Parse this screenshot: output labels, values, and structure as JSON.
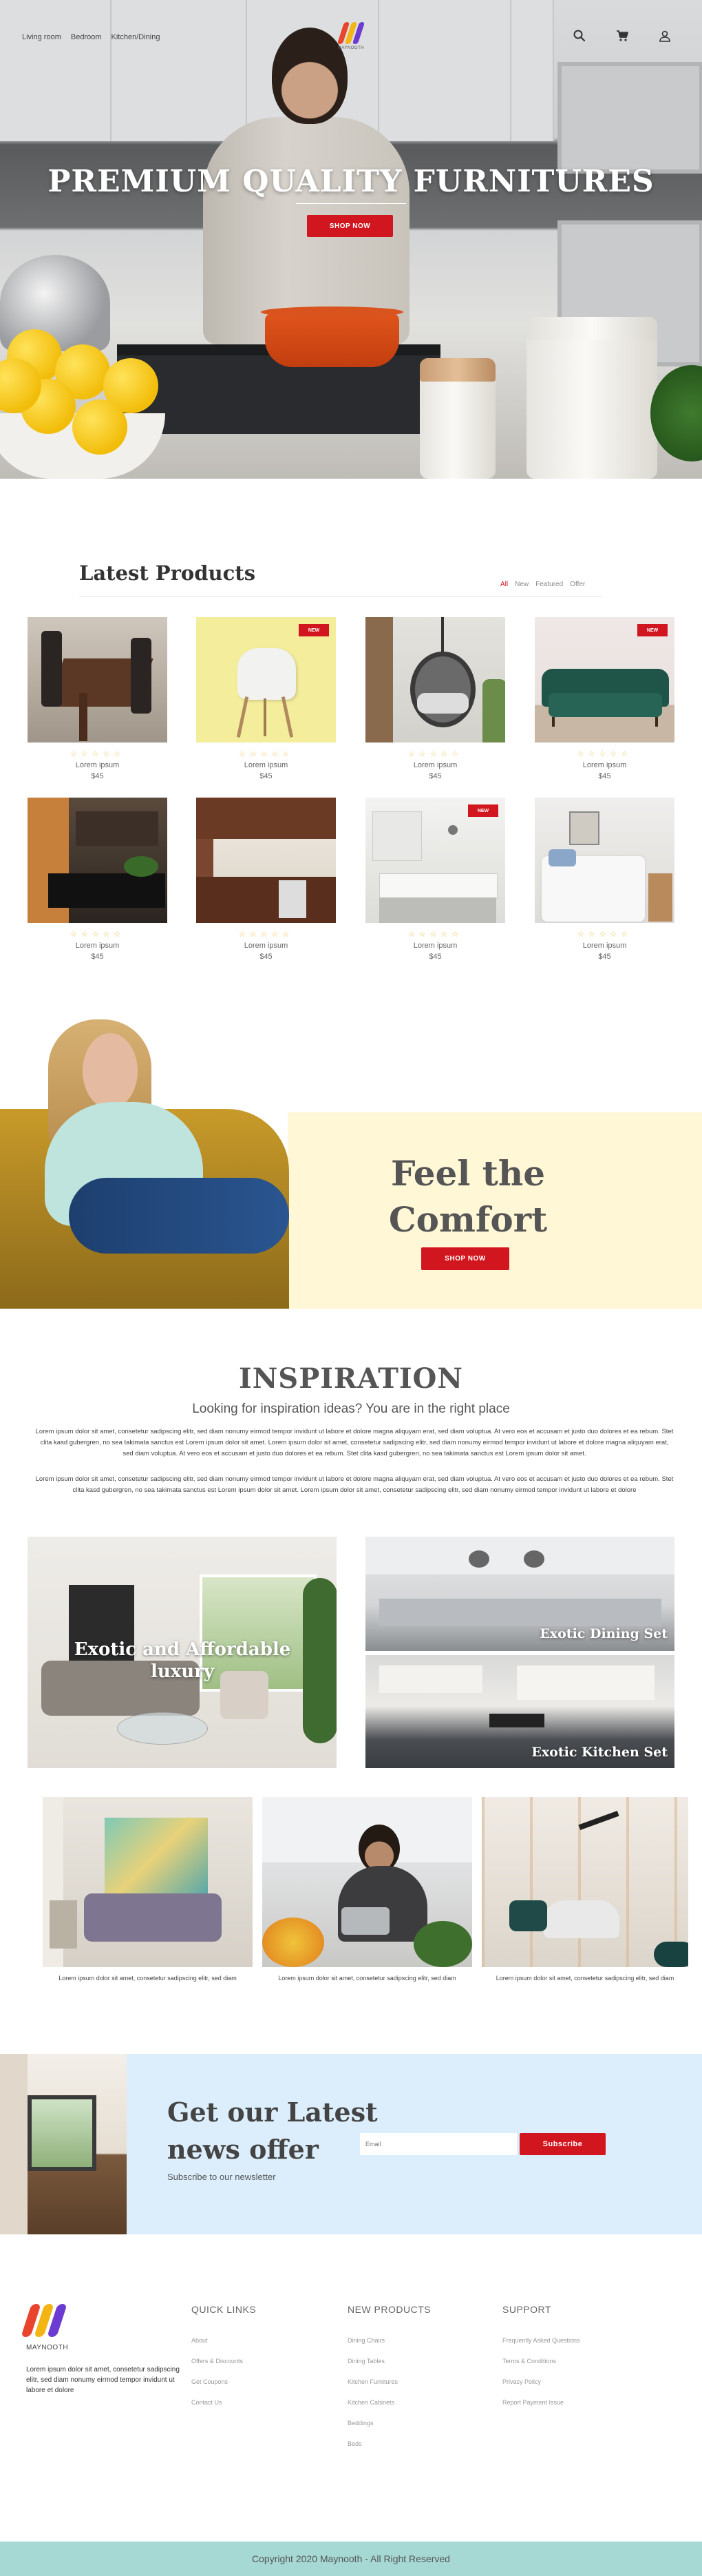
{
  "brand": {
    "name": "MAYNOOTH",
    "colors": {
      "accent": "#d2161f",
      "logo_bars": [
        "#e8452c",
        "#f3b414",
        "#6c3bd1"
      ]
    }
  },
  "nav": {
    "links": [
      "Living room",
      "Bedroom",
      "Kitchen/Dining"
    ],
    "icons": [
      "search-icon",
      "cart-icon",
      "user-icon"
    ]
  },
  "hero": {
    "title": "PREMIUM QUALITY FURNITURES",
    "button": "SHOP NOW"
  },
  "latest": {
    "title": "Latest Products",
    "filters": [
      "All",
      "New",
      "Featured",
      "Offer"
    ],
    "active_filter": "All",
    "badge_label": "NEW",
    "rating_stars": "☆☆☆☆☆",
    "products": [
      {
        "name": "Lorem ipsum",
        "price": "$45",
        "badge": false,
        "image": "dining-table"
      },
      {
        "name": "Lorem ipsum",
        "price": "$45",
        "badge": true,
        "image": "white-chair"
      },
      {
        "name": "Lorem ipsum",
        "price": "$45",
        "badge": false,
        "image": "hanging-chair"
      },
      {
        "name": "Lorem ipsum",
        "price": "$45",
        "badge": true,
        "image": "green-sofa"
      },
      {
        "name": "Lorem ipsum",
        "price": "$45",
        "badge": false,
        "image": "dark-kitchen"
      },
      {
        "name": "Lorem ipsum",
        "price": "$45",
        "badge": false,
        "image": "wood-kitchen"
      },
      {
        "name": "Lorem ipsum",
        "price": "$45",
        "badge": true,
        "image": "white-kitchen"
      },
      {
        "name": "Lorem ipsum",
        "price": "$45",
        "badge": false,
        "image": "bedroom"
      }
    ]
  },
  "comfort": {
    "title_line1": "Feel the",
    "title_line2": "Comfort",
    "button": "SHOP NOW"
  },
  "inspiration": {
    "title": "INSPIRATION",
    "subtitle": "Looking for inspiration ideas? You are in the right place",
    "para1": "Lorem ipsum dolor sit amet, consetetur sadipscing elitr, sed diam nonumy eirmod tempor invidunt ut labore et dolore magna aliquyam erat, sed diam voluptua. At vero eos et accusam et justo duo dolores et ea rebum. Stet clita kasd gubergren, no sea takimata sanctus est Lorem ipsum dolor sit amet. Lorem ipsum dolor sit amet, consetetur sadipscing elitr, sed diam nonumy eirmod tempor invidunt ut labore et dolore magna aliquyam erat, sed diam voluptua. At vero eos et accusam et justo duo dolores et ea rebum. Stet clita kasd gubergren, no sea takimata sanctus est Lorem ipsum dolor sit amet.",
    "para2": "Lorem ipsum dolor sit amet, consetetur sadipscing elitr, sed diam nonumy eirmod tempor invidunt ut labore et dolore magna aliquyam erat, sed diam voluptua. At vero eos et accusam et justo duo dolores et ea rebum. Stet clita kasd gubergren, no sea takimata sanctus est Lorem ipsum dolor sit amet. Lorem ipsum dolor sit amet, consetetur sadipscing elitr, sed diam nonumy eirmod tempor invidunt ut labore et dolore",
    "tiles": {
      "large": "Exotic and Affordable luxury",
      "dining": "Exotic Dining Set",
      "kitchen": "Exotic Kitchen Set"
    },
    "photo_captions": [
      "Lorem ipsum dolor sit amet, consetetur sadipscing elitr, sed diam",
      "Lorem ipsum dolor sit amet, consetetur sadipscing elitr, sed diam",
      "Lorem ipsum dolor sit amet, consetetur sadipscing elitr, sed diam"
    ]
  },
  "newsletter": {
    "title_line1": "Get our Latest",
    "title_line2": "news offer",
    "subtitle": "Subscribe to our newsletter",
    "email_placeholder": "Email",
    "button": "Subscribe"
  },
  "footer": {
    "about": "Lorem ipsum dolor sit amet, consetetur sadipscing elitr, sed diam nonumy eirmod tempor invidunt ut labore et dolore",
    "quick_links": {
      "title": "QUICK LINKS",
      "items": [
        "About",
        "Offers & Discounts",
        "Get Coupons",
        "Contact Us"
      ]
    },
    "new_products": {
      "title": "NEW PRODUCTS",
      "items": [
        "Dining Chairs",
        "Dining Tables",
        "Kitchen Furnitures",
        "Kitchen Cabinets",
        "Beddings",
        "Beds"
      ]
    },
    "support": {
      "title": "SUPPORT",
      "items": [
        "Frequently Asked Questions",
        "Terms & Conditions",
        "Privacy Policy",
        "Report Payment Issue"
      ]
    },
    "copyright": "Copyright 2020 Maynooth - All Right Reserved"
  }
}
